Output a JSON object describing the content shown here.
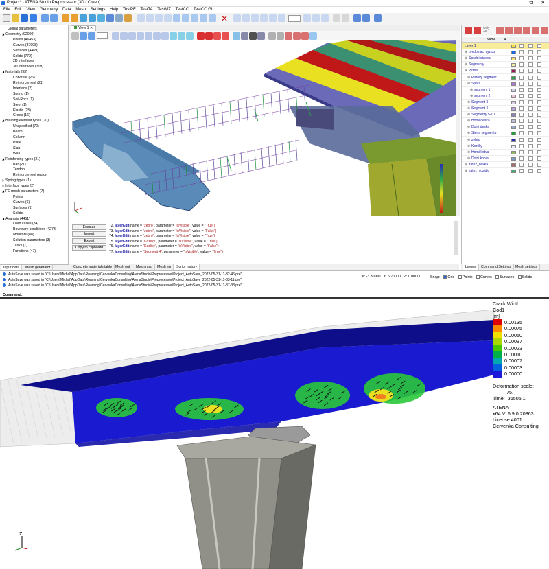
{
  "window": {
    "title": "Project* - ATENA Studio Preprocessor (3D - Creep)",
    "controls": [
      "—",
      "⧉",
      "✕"
    ]
  },
  "menu": [
    "File",
    "Edit",
    "View",
    "Geometry",
    "Data",
    "Mesh",
    "Settings",
    "Help",
    "TestPF",
    "TestTA",
    "TestMZ",
    "TestCC",
    "TestCC.GL"
  ],
  "left_tree": [
    {
      "label": "Global parameters",
      "level": 1,
      "arrow": ""
    },
    {
      "label": "Geometry (92000)",
      "level": 0,
      "arrow": "◢"
    },
    {
      "label": "Points (46453)",
      "level": 2,
      "arrow": ""
    },
    {
      "label": "Curves (37998)",
      "level": 2,
      "arrow": ""
    },
    {
      "label": "Surfaces (4469)",
      "level": 2,
      "arrow": ""
    },
    {
      "label": "Solids (772)",
      "level": 2,
      "arrow": ""
    },
    {
      "label": "2D interfaces",
      "level": 2,
      "arrow": ""
    },
    {
      "label": "3D interfaces (308)",
      "level": 2,
      "arrow": ""
    },
    {
      "label": "Materials (93)",
      "level": 0,
      "arrow": "◢"
    },
    {
      "label": "Concrete (26)",
      "level": 2,
      "arrow": ""
    },
    {
      "label": "Reinforcement (21)",
      "level": 2,
      "arrow": ""
    },
    {
      "label": "Interface (2)",
      "level": 2,
      "arrow": ""
    },
    {
      "label": "Spring (1)",
      "level": 2,
      "arrow": ""
    },
    {
      "label": "Soil-Rock (1)",
      "level": 2,
      "arrow": ""
    },
    {
      "label": "Steel (1)",
      "level": 2,
      "arrow": ""
    },
    {
      "label": "Elastic (25)",
      "level": 2,
      "arrow": ""
    },
    {
      "label": "Creep (16)",
      "level": 2,
      "arrow": ""
    },
    {
      "label": "Building element types (70)",
      "level": 0,
      "arrow": "◢"
    },
    {
      "label": "Unspecified (70)",
      "level": 2,
      "arrow": ""
    },
    {
      "label": "Beam",
      "level": 2,
      "arrow": ""
    },
    {
      "label": "Column",
      "level": 2,
      "arrow": ""
    },
    {
      "label": "Plate",
      "level": 2,
      "arrow": ""
    },
    {
      "label": "Slab",
      "level": 2,
      "arrow": ""
    },
    {
      "label": "Wall",
      "level": 2,
      "arrow": ""
    },
    {
      "label": "Reinforcing types (21)",
      "level": 0,
      "arrow": "◢"
    },
    {
      "label": "Bar (21)",
      "level": 2,
      "arrow": ""
    },
    {
      "label": "Tendon",
      "level": 2,
      "arrow": ""
    },
    {
      "label": "Reinforcement region",
      "level": 2,
      "arrow": ""
    },
    {
      "label": "Spring types (1)",
      "level": 0,
      "arrow": "▷"
    },
    {
      "label": "Interface types (2)",
      "level": 0,
      "arrow": "▷"
    },
    {
      "label": "FE mesh parameters (7)",
      "level": 0,
      "arrow": "◢"
    },
    {
      "label": "Points",
      "level": 2,
      "arrow": ""
    },
    {
      "label": "Curves (6)",
      "level": 2,
      "arrow": ""
    },
    {
      "label": "Surfaces (1)",
      "level": 2,
      "arrow": ""
    },
    {
      "label": "Solids",
      "level": 2,
      "arrow": ""
    },
    {
      "label": "Analysis (4451)",
      "level": 0,
      "arrow": "◢"
    },
    {
      "label": "Load cases (34)",
      "level": 2,
      "arrow": ""
    },
    {
      "label": "Boundary conditions (4278)",
      "level": 2,
      "arrow": ""
    },
    {
      "label": "Monitors (88)",
      "level": 2,
      "arrow": ""
    },
    {
      "label": "Solution parameters (3)",
      "level": 2,
      "arrow": ""
    },
    {
      "label": "Tasks (1)",
      "level": 2,
      "arrow": ""
    },
    {
      "label": "Functions (47)",
      "level": 2,
      "arrow": ""
    }
  ],
  "left_tabs": [
    "Input data",
    "Mesh generator"
  ],
  "view_tab": "View 1",
  "console": {
    "buttons": [
      "Execute",
      "Import",
      "Export",
      "Copy to clipboard"
    ],
    "lines": [
      {
        "n": "72.",
        "fn": "layerEdit",
        "args": "(name = ",
        "s1": "\"zebro\"",
        "mid": ", parameter = ",
        "s2": "\"isVisible\"",
        "mid2": ", value = ",
        "s3": "\"True\")"
      },
      {
        "n": "73.",
        "fn": "layerEdit",
        "args": "(name = ",
        "s1": "\"zebro\"",
        "mid": ", parameter = ",
        "s2": "\"isVisible\"",
        "mid2": ", value = ",
        "s3": "\"False\")"
      },
      {
        "n": "74.",
        "fn": "layerEdit",
        "args": "(name = ",
        "s1": "\"zebro\"",
        "mid": ", parameter = ",
        "s2": "\"isVisible\"",
        "mid2": ", value = ",
        "s3": "\"True\")"
      },
      {
        "n": "75.",
        "fn": "layerEdit",
        "args": "(name = ",
        "s1": "\"Kozliky\"",
        "mid": ", parameter = ",
        "s2": "\"isVisible\"",
        "mid2": ", value = ",
        "s3": "\"True\")"
      },
      {
        "n": "76.",
        "fn": "layerEdit",
        "args": "(name = ",
        "s1": "\"Kozliky\"",
        "mid": ", parameter = ",
        "s2": "\"isVisible\"",
        "mid2": ", value = ",
        "s3": "\"False\")"
      },
      {
        "n": "77.",
        "fn": "layerEdit",
        "args": "(name = ",
        "s1": "\"Segment 4\"",
        "mid": ", parameter = ",
        "s2": "\"isVisible\"",
        "mid2": ", value = ",
        "s3": "\"True\")"
      }
    ]
  },
  "bottom_tabs": [
    "Concrete materials table",
    "Mesh out",
    "Mesh msg",
    "Mesh err",
    "Script history"
  ],
  "right_panel": {
    "only_label": "Only",
    "all_label": "All",
    "headers": [
      "Name",
      "A",
      "C"
    ],
    "layers": [
      {
        "name": "Layer 1",
        "color": "#f7e04a",
        "indent": 0,
        "highlight": true
      },
      {
        "name": "predpinaci vyztuz",
        "color": "#1a66e0",
        "indent": 1
      },
      {
        "name": "Spodni stavba",
        "color": "#f5e26a",
        "indent": 1
      },
      {
        "name": "Segmenty",
        "color": "#f0f0a0",
        "indent": 1
      },
      {
        "name": "vyztuz",
        "color": "#a0145a",
        "indent": 1
      },
      {
        "name": "Pilirovy segment",
        "color": "#2aa84a",
        "indent": 2
      },
      {
        "name": "Spara",
        "color": "#b07ad8",
        "indent": 2
      },
      {
        "name": "segment 1",
        "color": "#d0d0f0",
        "indent": 3
      },
      {
        "name": "segment 2",
        "color": "#f2c8d8",
        "indent": 3
      },
      {
        "name": "Segment 3",
        "color": "#e0d0e8",
        "indent": 2
      },
      {
        "name": "Segment 4",
        "color": "#b89ee0",
        "indent": 2
      },
      {
        "name": "Segmenty 5-10",
        "color": "#8888b8",
        "indent": 2
      },
      {
        "name": "Horni deska",
        "color": "#c0c0d8",
        "indent": 2
      },
      {
        "name": "Dolni deska",
        "color": "#98a8d0",
        "indent": 2
      },
      {
        "name": "Stena segmentu",
        "color": "#2a9a3a",
        "indent": 2
      },
      {
        "name": "zebro",
        "color": "#2a2ab8",
        "indent": 2
      },
      {
        "name": "Kozliky",
        "color": "#e8e8f8",
        "indent": 2
      },
      {
        "name": "Horni kotva",
        "color": "#98b860",
        "indent": 2
      },
      {
        "name": "Dolni kotva",
        "color": "#7a9ac8",
        "indent": 2
      },
      {
        "name": "zatez_deska",
        "color": "#b06868",
        "indent": 1
      },
      {
        "name": "zatez_vozidlo",
        "color": "#48a878",
        "indent": 1
      }
    ],
    "tabs": [
      "Layers",
      "Command Settings",
      "Mesh settings"
    ]
  },
  "status": {
    "log": [
      "AutoSave was saved in \"C:\\Users\\Michal\\AppData\\Roaming\\CervenkaConsulting\\AtenaStudio\\Preprocessor\\Project_AutoSave_2022-05-31-11-32-46.pre\"",
      "AutoSave was saved in \"C:\\Users\\Michal\\AppData\\Roaming\\CervenkaConsulting\\AtenaStudio\\Preprocessor\\Project_AutoSave_2022-05-31-11-33-11.pre\"",
      "AutoSave was saved in \"C:\\Users\\Michal\\AppData\\Roaming\\CervenkaConsulting\\AtenaStudio\\Preprocessor\\Project_AutoSave_2022-05-31-11-37-38.pre\""
    ],
    "x_label": "X:",
    "x_value": "-3.80000",
    "y_label": "Y:",
    "y_value": "6.70000",
    "z_label": "Z:",
    "z_value": "0.00000",
    "snap_label": "Snap:",
    "snap_options": [
      "Grid",
      "Points",
      "Curves",
      "Surfaces",
      "Solids"
    ],
    "cmd_label": "Command:"
  },
  "result": {
    "legend_title": "Crack Width",
    "legend_sub": "Cod1",
    "legend_unit": "[m]",
    "legend_values": [
      "0.00135",
      "0.00075",
      "0.00050",
      "0.00037",
      "0.00023",
      "0.00010",
      "0.00007",
      "0.00003",
      "0.00000"
    ],
    "legend_colors": [
      "#e00000",
      "#ff8a00",
      "#f0e000",
      "#a8d800",
      "#48c800",
      "#00b048",
      "#00a8b0",
      "#0060e0",
      "#1a1ad8"
    ],
    "deform_label": "Deformation scale:",
    "deform_value": "75.",
    "time_label": "Time:",
    "time_value": "36505.1",
    "info": [
      "ATENA",
      "x64 V. 5.9.0.20863",
      "License 4001",
      "Cervenka Consulting"
    ]
  }
}
